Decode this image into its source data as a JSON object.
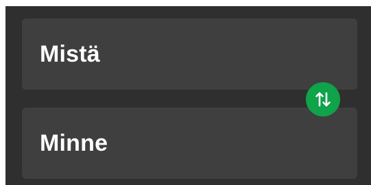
{
  "route": {
    "from_label": "Mistä",
    "to_label": "Minne"
  },
  "swap": {
    "icon": "swap-vertical-icon",
    "color": "#0fa34a"
  },
  "colors": {
    "panel_background": "#2f2f2f",
    "field_background": "#3f3f3f",
    "text": "#ffffff"
  }
}
